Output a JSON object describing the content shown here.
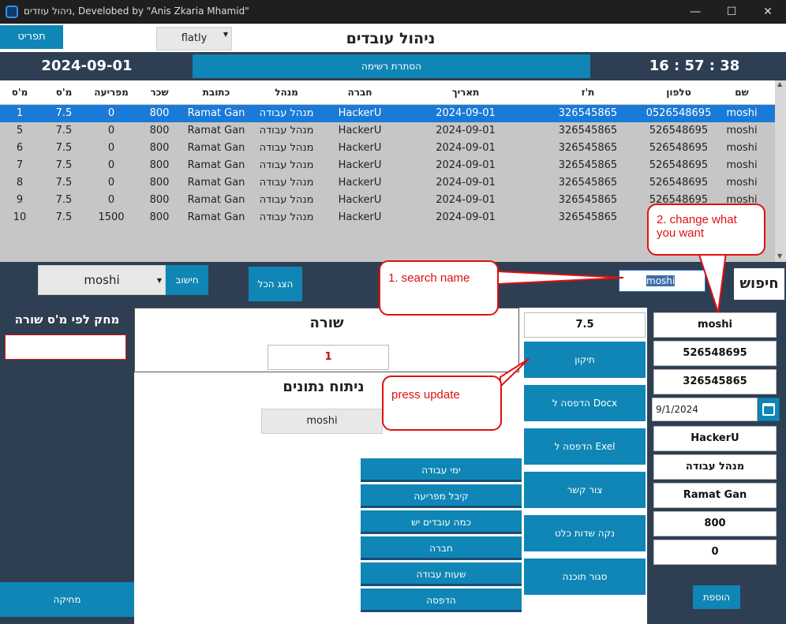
{
  "window": {
    "title": "ניהול עוזדים, Develobed by \"Anis Zkaria Mhamid\"",
    "minimize": "—",
    "maximize": "☐",
    "close": "✕"
  },
  "menu": {
    "menu_button": "תפריט",
    "theme": "flatly",
    "page_title": "ניהול עובדים"
  },
  "header": {
    "date": "2024-09-01",
    "hide_list_button": "הסתרת רשימה",
    "time": "16 : 57 : 38"
  },
  "table": {
    "columns": [
      "מ'ס שורה",
      "מ'ס שעות",
      "מפריעה",
      "שכר",
      "כתובת",
      "מנהל",
      "חברה",
      "תאריך",
      "ת'ז",
      "טלפון",
      "שם"
    ],
    "rows": [
      [
        "1",
        "7.5",
        "0",
        "800",
        "Ramat Gan",
        "מנהל עבודה",
        "HackerU",
        "2024-09-01",
        "326545865",
        "0526548695",
        "moshi"
      ],
      [
        "5",
        "7.5",
        "0",
        "800",
        "Ramat Gan",
        "מנהל עבודה",
        "HackerU",
        "2024-09-01",
        "326545865",
        "526548695",
        "moshi"
      ],
      [
        "6",
        "7.5",
        "0",
        "800",
        "Ramat Gan",
        "מנהל עבודה",
        "HackerU",
        "2024-09-01",
        "326545865",
        "526548695",
        "moshi"
      ],
      [
        "7",
        "7.5",
        "0",
        "800",
        "Ramat Gan",
        "מנהל עבודה",
        "HackerU",
        "2024-09-01",
        "326545865",
        "526548695",
        "moshi"
      ],
      [
        "8",
        "7.5",
        "0",
        "800",
        "Ramat Gan",
        "מנהל עבודה",
        "HackerU",
        "2024-09-01",
        "326545865",
        "526548695",
        "moshi"
      ],
      [
        "9",
        "7.5",
        "0",
        "800",
        "Ramat Gan",
        "מנהל עבודה",
        "HackerU",
        "2024-09-01",
        "326545865",
        "526548695",
        "moshi"
      ],
      [
        "10",
        "7.5",
        "1500",
        "800",
        "Ramat Gan",
        "מנהל עבודה",
        "HackerU",
        "2024-09-01",
        "326545865",
        "526548695",
        "moshi"
      ]
    ],
    "selected_row": 0
  },
  "toolbar": {
    "name_select": "moshi",
    "calc_button": "חישוב",
    "show_all_button": "הצג הכל",
    "search_value": "moshi",
    "search_label": "חיפוש"
  },
  "delete_panel": {
    "title": "מחק לפי מ'ס שורה",
    "input_value": "",
    "delete_button": "מחיקה"
  },
  "center": {
    "row_title": "שורה",
    "row_value": "1",
    "analysis_title": "ניתוח נתונים",
    "analysis_select": "moshi",
    "analysis_buttons": [
      "ימי עבודה",
      "קיבל מפריעה",
      "כמה עובדים יש",
      "חברה",
      "שעות עבודה",
      "הדפסה"
    ]
  },
  "actions": {
    "hours_value": "7.5",
    "buttons": [
      "תיקון",
      "הדפסה ל Docx",
      "הדפסה ל Exel",
      "צור קשר",
      "נקה שדות כלט",
      "סגור תוכנה"
    ]
  },
  "form": {
    "name": "moshi",
    "phone": "526548695",
    "id": "326545865",
    "date": "9/1/2024",
    "company": "HackerU",
    "manager": "מנהל עבודה",
    "address": "Ramat Gan",
    "salary": "800",
    "advance": "0",
    "add_button": "הוספת"
  },
  "callouts": {
    "search": "1. search name",
    "change": "2. change what you want",
    "update": "press update"
  },
  "colors": {
    "accent": "#0f86b5",
    "dark": "#2e3f53",
    "selected": "#1a7ad8",
    "annotation": "#e01010"
  }
}
